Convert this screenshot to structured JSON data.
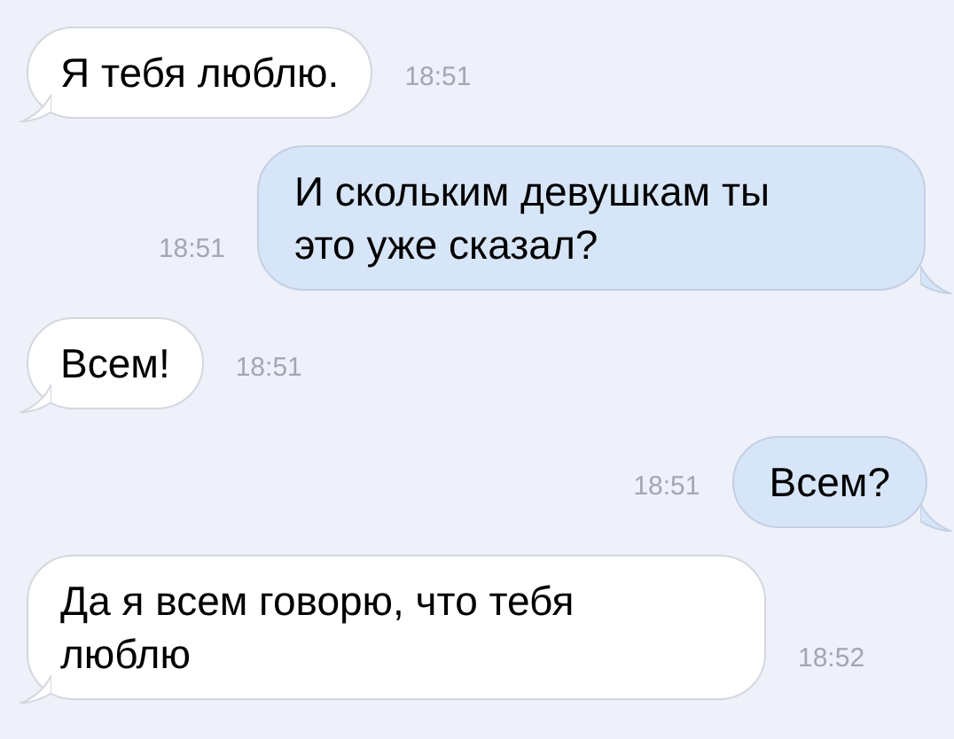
{
  "messages": [
    {
      "kind": "incoming",
      "text": "Я тебя люблю.",
      "time": "18:51"
    },
    {
      "kind": "outgoing",
      "text": "И скольким девушкам ты это уже сказал?",
      "time": "18:51"
    },
    {
      "kind": "incoming",
      "text": "Всем!",
      "time": "18:51"
    },
    {
      "kind": "outgoing",
      "text": "Всем?",
      "time": "18:51"
    },
    {
      "kind": "incoming",
      "text": "Да я всем говорю, что тебя люблю",
      "time": "18:52"
    }
  ]
}
